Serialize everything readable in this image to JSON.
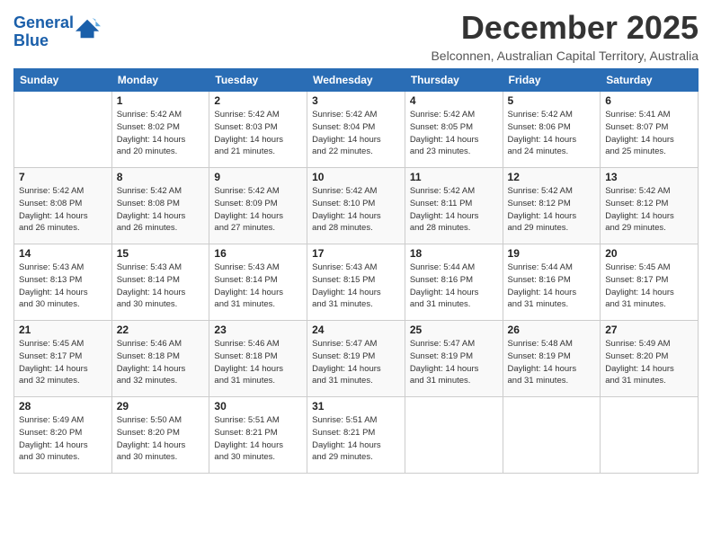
{
  "logo": {
    "line1": "General",
    "line2": "Blue"
  },
  "title": "December 2025",
  "location": "Belconnen, Australian Capital Territory, Australia",
  "weekdays": [
    "Sunday",
    "Monday",
    "Tuesday",
    "Wednesday",
    "Thursday",
    "Friday",
    "Saturday"
  ],
  "weeks": [
    [
      {
        "day": "",
        "info": ""
      },
      {
        "day": "1",
        "info": "Sunrise: 5:42 AM\nSunset: 8:02 PM\nDaylight: 14 hours\nand 20 minutes."
      },
      {
        "day": "2",
        "info": "Sunrise: 5:42 AM\nSunset: 8:03 PM\nDaylight: 14 hours\nand 21 minutes."
      },
      {
        "day": "3",
        "info": "Sunrise: 5:42 AM\nSunset: 8:04 PM\nDaylight: 14 hours\nand 22 minutes."
      },
      {
        "day": "4",
        "info": "Sunrise: 5:42 AM\nSunset: 8:05 PM\nDaylight: 14 hours\nand 23 minutes."
      },
      {
        "day": "5",
        "info": "Sunrise: 5:42 AM\nSunset: 8:06 PM\nDaylight: 14 hours\nand 24 minutes."
      },
      {
        "day": "6",
        "info": "Sunrise: 5:41 AM\nSunset: 8:07 PM\nDaylight: 14 hours\nand 25 minutes."
      }
    ],
    [
      {
        "day": "7",
        "info": "Sunrise: 5:42 AM\nSunset: 8:08 PM\nDaylight: 14 hours\nand 26 minutes."
      },
      {
        "day": "8",
        "info": "Sunrise: 5:42 AM\nSunset: 8:08 PM\nDaylight: 14 hours\nand 26 minutes."
      },
      {
        "day": "9",
        "info": "Sunrise: 5:42 AM\nSunset: 8:09 PM\nDaylight: 14 hours\nand 27 minutes."
      },
      {
        "day": "10",
        "info": "Sunrise: 5:42 AM\nSunset: 8:10 PM\nDaylight: 14 hours\nand 28 minutes."
      },
      {
        "day": "11",
        "info": "Sunrise: 5:42 AM\nSunset: 8:11 PM\nDaylight: 14 hours\nand 28 minutes."
      },
      {
        "day": "12",
        "info": "Sunrise: 5:42 AM\nSunset: 8:12 PM\nDaylight: 14 hours\nand 29 minutes."
      },
      {
        "day": "13",
        "info": "Sunrise: 5:42 AM\nSunset: 8:12 PM\nDaylight: 14 hours\nand 29 minutes."
      }
    ],
    [
      {
        "day": "14",
        "info": "Sunrise: 5:43 AM\nSunset: 8:13 PM\nDaylight: 14 hours\nand 30 minutes."
      },
      {
        "day": "15",
        "info": "Sunrise: 5:43 AM\nSunset: 8:14 PM\nDaylight: 14 hours\nand 30 minutes."
      },
      {
        "day": "16",
        "info": "Sunrise: 5:43 AM\nSunset: 8:14 PM\nDaylight: 14 hours\nand 31 minutes."
      },
      {
        "day": "17",
        "info": "Sunrise: 5:43 AM\nSunset: 8:15 PM\nDaylight: 14 hours\nand 31 minutes."
      },
      {
        "day": "18",
        "info": "Sunrise: 5:44 AM\nSunset: 8:16 PM\nDaylight: 14 hours\nand 31 minutes."
      },
      {
        "day": "19",
        "info": "Sunrise: 5:44 AM\nSunset: 8:16 PM\nDaylight: 14 hours\nand 31 minutes."
      },
      {
        "day": "20",
        "info": "Sunrise: 5:45 AM\nSunset: 8:17 PM\nDaylight: 14 hours\nand 31 minutes."
      }
    ],
    [
      {
        "day": "21",
        "info": "Sunrise: 5:45 AM\nSunset: 8:17 PM\nDaylight: 14 hours\nand 32 minutes."
      },
      {
        "day": "22",
        "info": "Sunrise: 5:46 AM\nSunset: 8:18 PM\nDaylight: 14 hours\nand 32 minutes."
      },
      {
        "day": "23",
        "info": "Sunrise: 5:46 AM\nSunset: 8:18 PM\nDaylight: 14 hours\nand 31 minutes."
      },
      {
        "day": "24",
        "info": "Sunrise: 5:47 AM\nSunset: 8:19 PM\nDaylight: 14 hours\nand 31 minutes."
      },
      {
        "day": "25",
        "info": "Sunrise: 5:47 AM\nSunset: 8:19 PM\nDaylight: 14 hours\nand 31 minutes."
      },
      {
        "day": "26",
        "info": "Sunrise: 5:48 AM\nSunset: 8:19 PM\nDaylight: 14 hours\nand 31 minutes."
      },
      {
        "day": "27",
        "info": "Sunrise: 5:49 AM\nSunset: 8:20 PM\nDaylight: 14 hours\nand 31 minutes."
      }
    ],
    [
      {
        "day": "28",
        "info": "Sunrise: 5:49 AM\nSunset: 8:20 PM\nDaylight: 14 hours\nand 30 minutes."
      },
      {
        "day": "29",
        "info": "Sunrise: 5:50 AM\nSunset: 8:20 PM\nDaylight: 14 hours\nand 30 minutes."
      },
      {
        "day": "30",
        "info": "Sunrise: 5:51 AM\nSunset: 8:21 PM\nDaylight: 14 hours\nand 30 minutes."
      },
      {
        "day": "31",
        "info": "Sunrise: 5:51 AM\nSunset: 8:21 PM\nDaylight: 14 hours\nand 29 minutes."
      },
      {
        "day": "",
        "info": ""
      },
      {
        "day": "",
        "info": ""
      },
      {
        "day": "",
        "info": ""
      }
    ]
  ]
}
